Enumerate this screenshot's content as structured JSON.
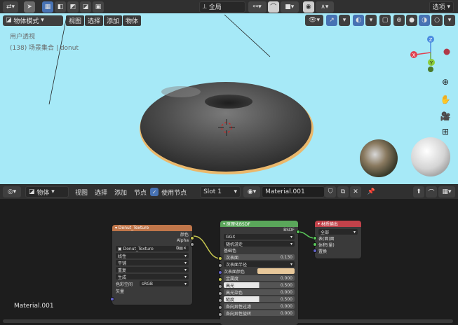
{
  "top_bar": {
    "transform_orientation": "全局",
    "options_label": "选项"
  },
  "viewport_header": {
    "mode": "物体模式",
    "menus": [
      "视图",
      "选择",
      "添加",
      "物体"
    ]
  },
  "viewport": {
    "view_name": "用户透视",
    "collection_info": "(138) 场景集合 | donut"
  },
  "node_editor_header": {
    "object_dropdown": "物体",
    "menus": [
      "视图",
      "选择",
      "添加",
      "节点"
    ],
    "use_nodes_label": "使用节点",
    "slot": "Slot 1",
    "material_name": "Material.001"
  },
  "node_editor": {
    "material_label": "Material.001",
    "image_node": {
      "title": "Donut_Texture",
      "outputs": [
        "颜色",
        "Alpha"
      ],
      "image_name": "Donut_Texture",
      "settings": [
        "线性",
        "平铺",
        "重复",
        "生成"
      ],
      "colorspace_label": "色彩空间",
      "colorspace_value": "sRGB",
      "input_vector": "矢量"
    },
    "bsdf_node": {
      "title": "原理化BSDF",
      "output": "BSDF",
      "distribution": "GGX",
      "subsurface_method": "随机游走",
      "base_color": "基础色",
      "subsurface_label": "次表面",
      "subsurface_value": "0.130",
      "subsurface_radius": "次表面半径",
      "subsurface_color": "次表面颜色",
      "metallic_label": "金属度",
      "metallic_value": "0.000",
      "specular_label": "高光",
      "specular_value": "0.500",
      "specular_tint_label": "高光染色",
      "specular_tint_value": "0.000",
      "roughness_label": "糙度",
      "roughness_value": "0.500",
      "anisotropic_label": "各向异性过滤",
      "anisotropic_value": "0.000",
      "aniso_rot_label": "各向异性旋转",
      "aniso_rot_value": "0.000"
    },
    "output_node": {
      "title": "材质输出",
      "target": "全部",
      "inputs": [
        "表(面)面",
        "体积(量)",
        "置换"
      ]
    }
  },
  "colors": {
    "viewport_bg": "#a6e9f7",
    "image_node_header": "#c0764a",
    "bsdf_node_header": "#5aa65a",
    "output_node_header": "#c2424a",
    "active_blue": "#4772b3"
  }
}
